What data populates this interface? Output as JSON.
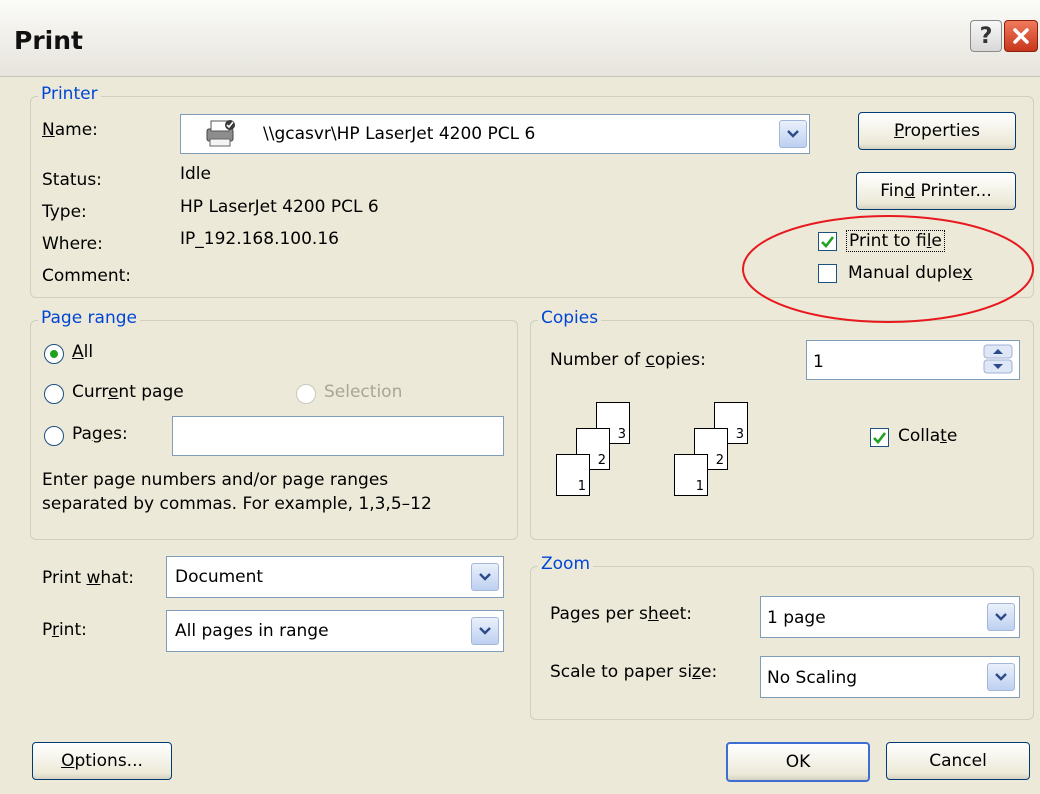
{
  "window": {
    "title": "Print",
    "help_label": "?",
    "close_label": "✕"
  },
  "printer": {
    "legend": "Printer",
    "name_label": "Name:",
    "name_value": "\\\\gcasvr\\HP LaserJet 4200 PCL 6",
    "status_label": "Status:",
    "status_value": "Idle",
    "type_label": "Type:",
    "type_value": "HP LaserJet 4200 PCL 6",
    "where_label": "Where:",
    "where_value": "IP_192.168.100.16",
    "comment_label": "Comment:",
    "comment_value": "",
    "properties_label": "Properties",
    "find_printer_label": "Find Printer...",
    "print_to_file_label": "Print to file",
    "print_to_file_checked": true,
    "manual_duplex_label": "Manual duplex",
    "manual_duplex_checked": false
  },
  "page_range": {
    "legend": "Page range",
    "all_label": "All",
    "current_label": "Current page",
    "selection_label": "Selection",
    "pages_label": "Pages:",
    "pages_value": "",
    "selected": "all",
    "hint_line1": "Enter page numbers and/or page ranges",
    "hint_line2": "separated by commas.  For example, 1,3,5–12"
  },
  "copies": {
    "legend": "Copies",
    "number_label": "Number of copies:",
    "number_value": "1",
    "collate_label": "Collate",
    "collate_checked": true,
    "page_numbers": [
      "1",
      "2",
      "3"
    ]
  },
  "print_what": {
    "label": "Print what:",
    "value": "Document"
  },
  "print": {
    "label": "Print:",
    "value": "All pages in range"
  },
  "zoom": {
    "legend": "Zoom",
    "pages_per_sheet_label": "Pages per sheet:",
    "pages_per_sheet_value": "1 page",
    "scale_label": "Scale to paper size:",
    "scale_value": "No Scaling"
  },
  "buttons": {
    "options": "Options...",
    "ok": "OK",
    "cancel": "Cancel"
  },
  "colors": {
    "accent": "#0046d5",
    "highlight_circle": "#e8191e",
    "check_green": "#21a121"
  },
  "icons": {
    "printer": "printer-icon",
    "dropdown": "chevron-down-icon",
    "spinner": "spinner-arrows-icon"
  }
}
